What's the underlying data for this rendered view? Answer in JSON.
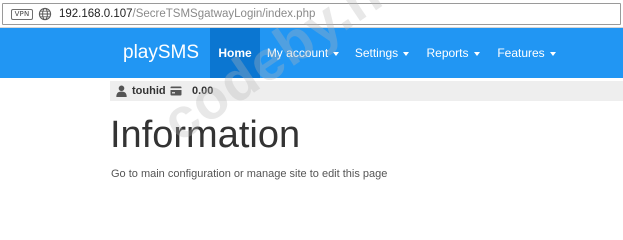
{
  "browser": {
    "vpn_label": "VPN",
    "url_host": "192.168.0.107",
    "url_path": "/SecreTSMSgatwayLogin/index.php"
  },
  "navbar": {
    "brand": "playSMS",
    "background": "#2196f3",
    "active_background": "#0b76d1",
    "items": [
      {
        "label": "Home",
        "active": true,
        "dropdown": false
      },
      {
        "label": "My account",
        "active": false,
        "dropdown": true
      },
      {
        "label": "Settings",
        "active": false,
        "dropdown": true
      },
      {
        "label": "Reports",
        "active": false,
        "dropdown": true
      },
      {
        "label": "Features",
        "active": false,
        "dropdown": true
      }
    ]
  },
  "userbar": {
    "username": "touhid",
    "credit": "0.00",
    "user_icon": "user-icon",
    "credit_icon": "credit-card-icon"
  },
  "main": {
    "title": "Information",
    "text": "Go to main configuration or manage site to edit this page"
  },
  "watermark": "codeby.net"
}
